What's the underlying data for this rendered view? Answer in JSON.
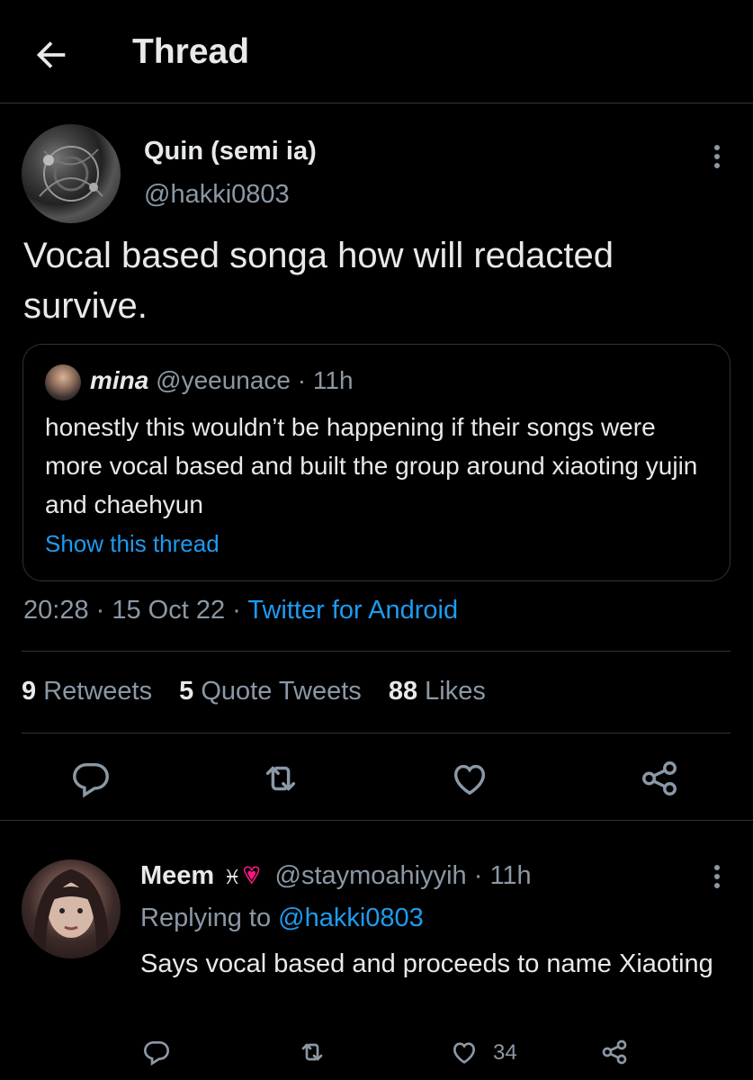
{
  "header": {
    "title": "Thread"
  },
  "tweet": {
    "author_name": "Quin (semi ia)",
    "author_handle": "@hakki0803",
    "text": "Vocal based songa how will redacted survive.",
    "quote": {
      "name": "mina",
      "meta": "@yeeunace · 11h",
      "text": "honestly this wouldn’t be happening if their songs were more vocal based and built the group around xiaoting yujin and chaehyun",
      "show_thread": "Show this thread"
    },
    "time": "20:28",
    "date": "15 Oct 22",
    "source": "Twitter for Android",
    "stats": {
      "retweets_count": "9",
      "retweets_label": "Retweets",
      "quotes_count": "5",
      "quotes_label": "Quote Tweets",
      "likes_count": "88",
      "likes_label": "Likes"
    }
  },
  "reply": {
    "name": "Meem",
    "symbol": "♓︎",
    "handle_meta": "@staymoahiyyih · 11h",
    "replying_prefix": "Replying to",
    "replying_to": "@hakki0803",
    "text": "Says vocal based and proceeds to name Xiaoting",
    "like_count": "34"
  },
  "colors": {
    "accent": "#1d9bf0",
    "background": "#000000",
    "muted": "#8b98a5",
    "heart": "#f91880"
  }
}
